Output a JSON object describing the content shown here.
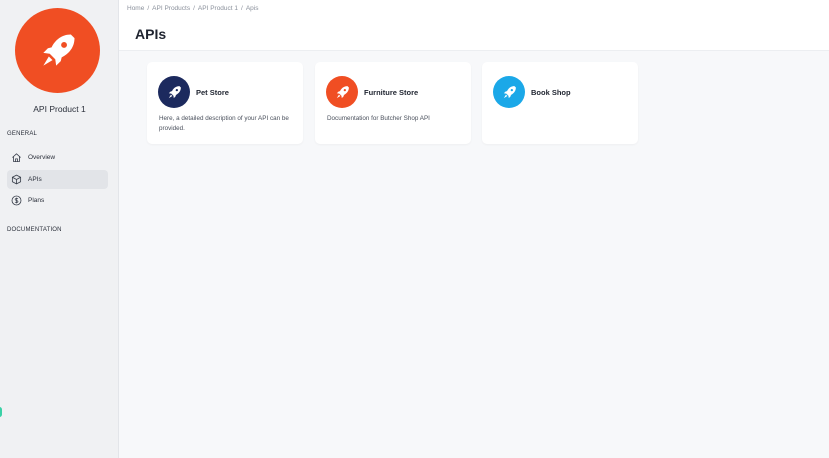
{
  "sidebar": {
    "product_name": "API Product 1",
    "logo_color": "#f04e23",
    "sections": {
      "general": "GENERAL",
      "documentation": "DOCUMENTATION"
    },
    "items": [
      {
        "label": "Overview",
        "icon": "home-icon",
        "active": false
      },
      {
        "label": "APIs",
        "icon": "cube-icon",
        "active": true
      },
      {
        "label": "Plans",
        "icon": "dollar-icon",
        "active": false
      }
    ]
  },
  "header": {
    "breadcrumb": [
      "Home",
      "API Products",
      "API Product 1",
      "Apis"
    ],
    "separator": "/",
    "title": "APIs"
  },
  "cards": [
    {
      "title": "Pet Store",
      "description": "Here, a detailed description of your API can be provided.",
      "color": "#1c2a5e",
      "icon": "rocket-icon"
    },
    {
      "title": "Furniture Store",
      "description": "Documentation for Butcher Shop API",
      "color": "#f04e23",
      "icon": "rocket-icon"
    },
    {
      "title": "Book Shop",
      "description": "",
      "color": "#1ba8e8",
      "icon": "rocket-icon"
    }
  ]
}
